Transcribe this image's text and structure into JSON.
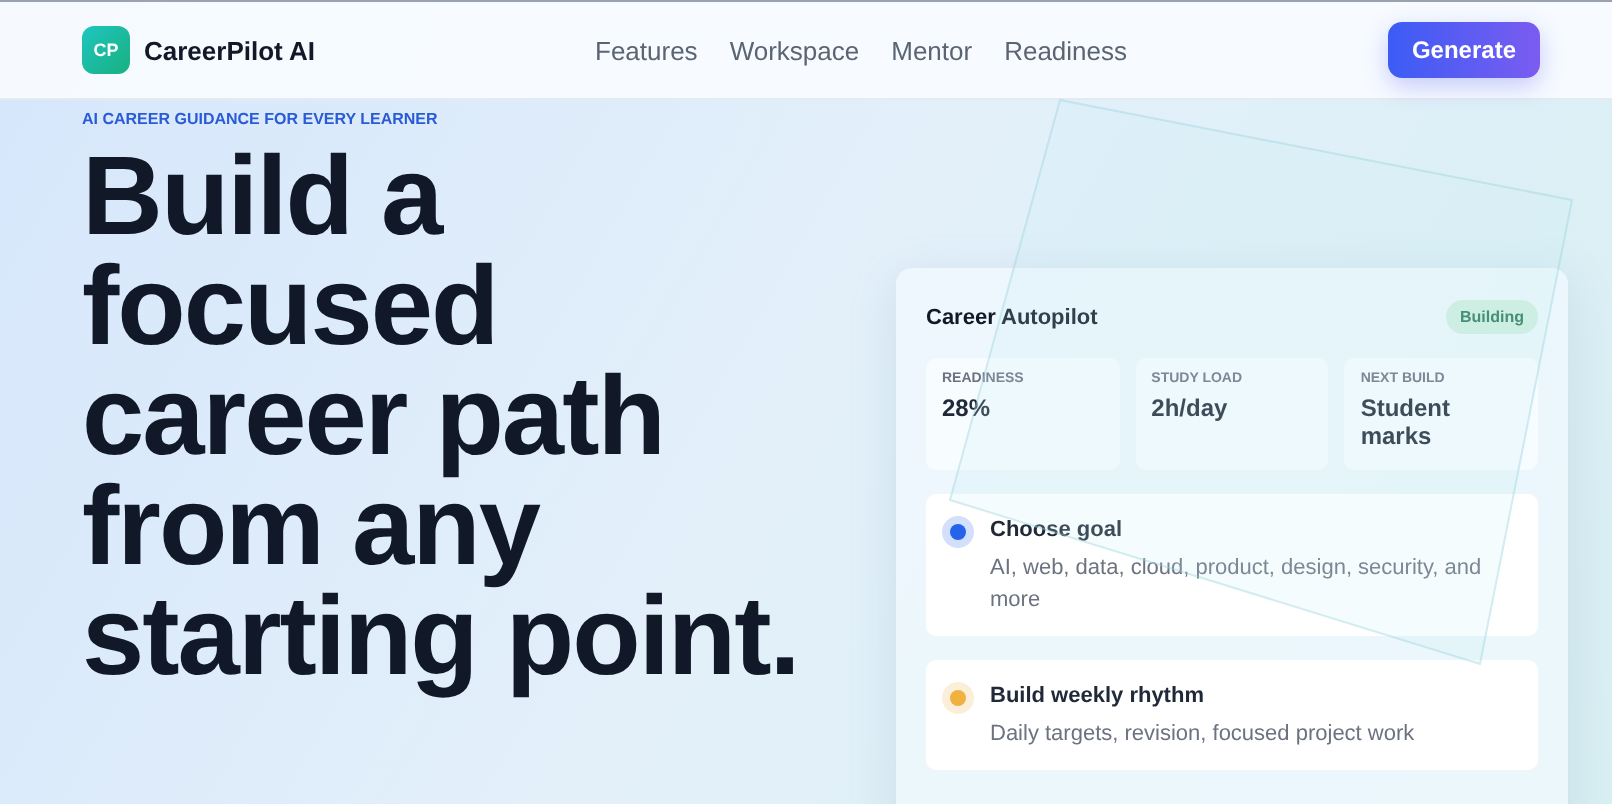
{
  "brand": {
    "logo": "CP",
    "name": "CareerPilot AI"
  },
  "nav": [
    "Features",
    "Workspace",
    "Mentor",
    "Readiness"
  ],
  "cta": "Generate",
  "eyebrow": "AI CAREER GUIDANCE FOR EVERY LEARNER",
  "headline": "Build a focused career path from any starting point.",
  "card": {
    "title": "Career Autopilot",
    "badge": "Building",
    "stats": [
      {
        "label": "READINESS",
        "value": "28%"
      },
      {
        "label": "STUDY LOAD",
        "value": "2h/day"
      },
      {
        "label": "NEXT BUILD",
        "value": "Student marks"
      }
    ],
    "steps": [
      {
        "title": "Choose goal",
        "text": "AI, web, data, cloud, product, design, security, and more",
        "color": "#2563eb"
      },
      {
        "title": "Build weekly rhythm",
        "text": "Daily targets, revision, focused project work",
        "color": "#f0b13f"
      }
    ]
  }
}
